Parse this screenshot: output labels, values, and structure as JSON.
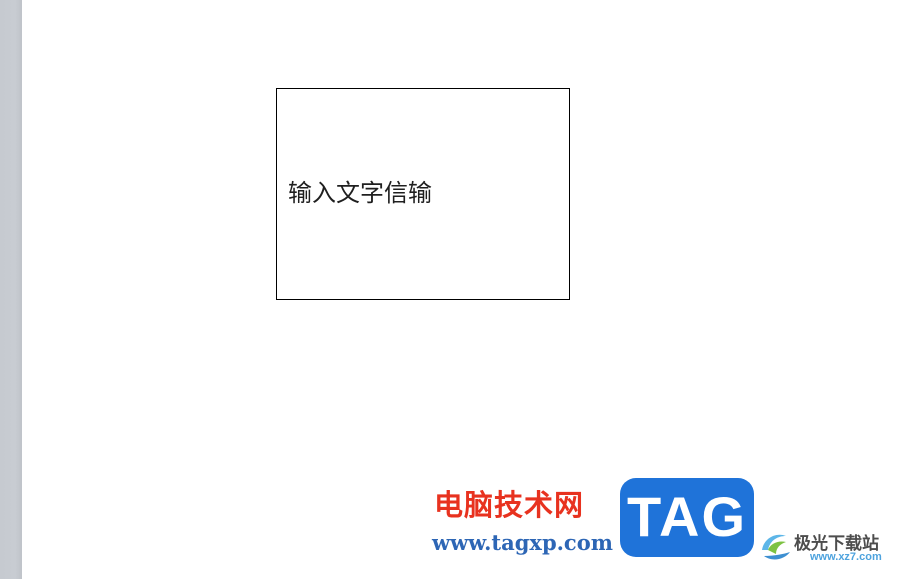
{
  "document": {
    "text_box_content": "输入文字信输"
  },
  "watermark": {
    "site_name": "电脑技术网",
    "site_url": "www.tagxp.com",
    "tag_logo_text": "TAG",
    "partner_name": "极光下载站",
    "partner_domain": "www.xz7.com",
    "colors": {
      "site_name": "#e8321f",
      "site_url": "#2d66b5",
      "tag_box": "#1f73d9",
      "partner_name": "#4d4d4d",
      "partner_domain": "#4ea3de"
    }
  },
  "icons": {
    "partner_logo": "swirl-logo-icon"
  }
}
